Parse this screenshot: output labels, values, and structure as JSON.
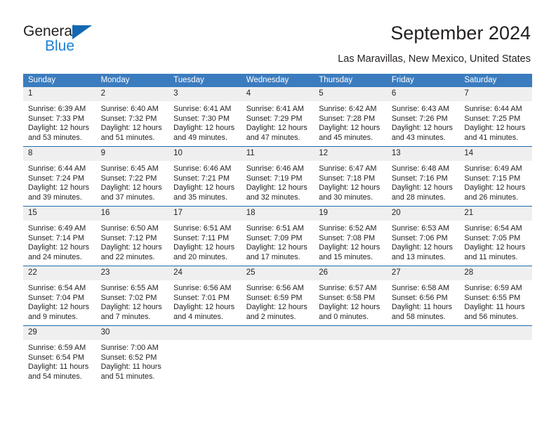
{
  "brand": {
    "name_part1": "General",
    "name_part2": "Blue",
    "triangle_color": "#1268b3",
    "blue_color": "#1b7fd4"
  },
  "header": {
    "title": "September 2024",
    "subtitle": "Las Maravillas, New Mexico, United States",
    "header_bg": "#3b7cbf",
    "row_divider": "#1f6cb0",
    "daynum_bg": "#efefef"
  },
  "weekday_headers": [
    "Sunday",
    "Monday",
    "Tuesday",
    "Wednesday",
    "Thursday",
    "Friday",
    "Saturday"
  ],
  "weeks": [
    [
      {
        "day": "1",
        "sunrise": "Sunrise: 6:39 AM",
        "sunset": "Sunset: 7:33 PM",
        "daylight1": "Daylight: 12 hours",
        "daylight2": "and 53 minutes."
      },
      {
        "day": "2",
        "sunrise": "Sunrise: 6:40 AM",
        "sunset": "Sunset: 7:32 PM",
        "daylight1": "Daylight: 12 hours",
        "daylight2": "and 51 minutes."
      },
      {
        "day": "3",
        "sunrise": "Sunrise: 6:41 AM",
        "sunset": "Sunset: 7:30 PM",
        "daylight1": "Daylight: 12 hours",
        "daylight2": "and 49 minutes."
      },
      {
        "day": "4",
        "sunrise": "Sunrise: 6:41 AM",
        "sunset": "Sunset: 7:29 PM",
        "daylight1": "Daylight: 12 hours",
        "daylight2": "and 47 minutes."
      },
      {
        "day": "5",
        "sunrise": "Sunrise: 6:42 AM",
        "sunset": "Sunset: 7:28 PM",
        "daylight1": "Daylight: 12 hours",
        "daylight2": "and 45 minutes."
      },
      {
        "day": "6",
        "sunrise": "Sunrise: 6:43 AM",
        "sunset": "Sunset: 7:26 PM",
        "daylight1": "Daylight: 12 hours",
        "daylight2": "and 43 minutes."
      },
      {
        "day": "7",
        "sunrise": "Sunrise: 6:44 AM",
        "sunset": "Sunset: 7:25 PM",
        "daylight1": "Daylight: 12 hours",
        "daylight2": "and 41 minutes."
      }
    ],
    [
      {
        "day": "8",
        "sunrise": "Sunrise: 6:44 AM",
        "sunset": "Sunset: 7:24 PM",
        "daylight1": "Daylight: 12 hours",
        "daylight2": "and 39 minutes."
      },
      {
        "day": "9",
        "sunrise": "Sunrise: 6:45 AM",
        "sunset": "Sunset: 7:22 PM",
        "daylight1": "Daylight: 12 hours",
        "daylight2": "and 37 minutes."
      },
      {
        "day": "10",
        "sunrise": "Sunrise: 6:46 AM",
        "sunset": "Sunset: 7:21 PM",
        "daylight1": "Daylight: 12 hours",
        "daylight2": "and 35 minutes."
      },
      {
        "day": "11",
        "sunrise": "Sunrise: 6:46 AM",
        "sunset": "Sunset: 7:19 PM",
        "daylight1": "Daylight: 12 hours",
        "daylight2": "and 32 minutes."
      },
      {
        "day": "12",
        "sunrise": "Sunrise: 6:47 AM",
        "sunset": "Sunset: 7:18 PM",
        "daylight1": "Daylight: 12 hours",
        "daylight2": "and 30 minutes."
      },
      {
        "day": "13",
        "sunrise": "Sunrise: 6:48 AM",
        "sunset": "Sunset: 7:16 PM",
        "daylight1": "Daylight: 12 hours",
        "daylight2": "and 28 minutes."
      },
      {
        "day": "14",
        "sunrise": "Sunrise: 6:49 AM",
        "sunset": "Sunset: 7:15 PM",
        "daylight1": "Daylight: 12 hours",
        "daylight2": "and 26 minutes."
      }
    ],
    [
      {
        "day": "15",
        "sunrise": "Sunrise: 6:49 AM",
        "sunset": "Sunset: 7:14 PM",
        "daylight1": "Daylight: 12 hours",
        "daylight2": "and 24 minutes."
      },
      {
        "day": "16",
        "sunrise": "Sunrise: 6:50 AM",
        "sunset": "Sunset: 7:12 PM",
        "daylight1": "Daylight: 12 hours",
        "daylight2": "and 22 minutes."
      },
      {
        "day": "17",
        "sunrise": "Sunrise: 6:51 AM",
        "sunset": "Sunset: 7:11 PM",
        "daylight1": "Daylight: 12 hours",
        "daylight2": "and 20 minutes."
      },
      {
        "day": "18",
        "sunrise": "Sunrise: 6:51 AM",
        "sunset": "Sunset: 7:09 PM",
        "daylight1": "Daylight: 12 hours",
        "daylight2": "and 17 minutes."
      },
      {
        "day": "19",
        "sunrise": "Sunrise: 6:52 AM",
        "sunset": "Sunset: 7:08 PM",
        "daylight1": "Daylight: 12 hours",
        "daylight2": "and 15 minutes."
      },
      {
        "day": "20",
        "sunrise": "Sunrise: 6:53 AM",
        "sunset": "Sunset: 7:06 PM",
        "daylight1": "Daylight: 12 hours",
        "daylight2": "and 13 minutes."
      },
      {
        "day": "21",
        "sunrise": "Sunrise: 6:54 AM",
        "sunset": "Sunset: 7:05 PM",
        "daylight1": "Daylight: 12 hours",
        "daylight2": "and 11 minutes."
      }
    ],
    [
      {
        "day": "22",
        "sunrise": "Sunrise: 6:54 AM",
        "sunset": "Sunset: 7:04 PM",
        "daylight1": "Daylight: 12 hours",
        "daylight2": "and 9 minutes."
      },
      {
        "day": "23",
        "sunrise": "Sunrise: 6:55 AM",
        "sunset": "Sunset: 7:02 PM",
        "daylight1": "Daylight: 12 hours",
        "daylight2": "and 7 minutes."
      },
      {
        "day": "24",
        "sunrise": "Sunrise: 6:56 AM",
        "sunset": "Sunset: 7:01 PM",
        "daylight1": "Daylight: 12 hours",
        "daylight2": "and 4 minutes."
      },
      {
        "day": "25",
        "sunrise": "Sunrise: 6:56 AM",
        "sunset": "Sunset: 6:59 PM",
        "daylight1": "Daylight: 12 hours",
        "daylight2": "and 2 minutes."
      },
      {
        "day": "26",
        "sunrise": "Sunrise: 6:57 AM",
        "sunset": "Sunset: 6:58 PM",
        "daylight1": "Daylight: 12 hours",
        "daylight2": "and 0 minutes."
      },
      {
        "day": "27",
        "sunrise": "Sunrise: 6:58 AM",
        "sunset": "Sunset: 6:56 PM",
        "daylight1": "Daylight: 11 hours",
        "daylight2": "and 58 minutes."
      },
      {
        "day": "28",
        "sunrise": "Sunrise: 6:59 AM",
        "sunset": "Sunset: 6:55 PM",
        "daylight1": "Daylight: 11 hours",
        "daylight2": "and 56 minutes."
      }
    ],
    [
      {
        "day": "29",
        "sunrise": "Sunrise: 6:59 AM",
        "sunset": "Sunset: 6:54 PM",
        "daylight1": "Daylight: 11 hours",
        "daylight2": "and 54 minutes."
      },
      {
        "day": "30",
        "sunrise": "Sunrise: 7:00 AM",
        "sunset": "Sunset: 6:52 PM",
        "daylight1": "Daylight: 11 hours",
        "daylight2": "and 51 minutes."
      },
      {
        "day": "",
        "sunrise": "",
        "sunset": "",
        "daylight1": "",
        "daylight2": ""
      },
      {
        "day": "",
        "sunrise": "",
        "sunset": "",
        "daylight1": "",
        "daylight2": ""
      },
      {
        "day": "",
        "sunrise": "",
        "sunset": "",
        "daylight1": "",
        "daylight2": ""
      },
      {
        "day": "",
        "sunrise": "",
        "sunset": "",
        "daylight1": "",
        "daylight2": ""
      },
      {
        "day": "",
        "sunrise": "",
        "sunset": "",
        "daylight1": "",
        "daylight2": ""
      }
    ]
  ]
}
